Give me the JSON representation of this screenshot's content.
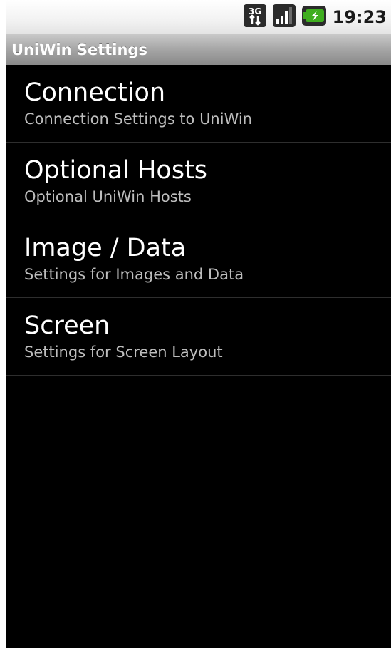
{
  "status_bar": {
    "network_badge": "3G",
    "network_icon": "3g-data-icon",
    "signal_icon": "signal-strength-icon",
    "battery_icon": "battery-charging-icon",
    "time": "19:23"
  },
  "title_bar": {
    "title": "UniWin Settings"
  },
  "preferences": [
    {
      "title": "Connection",
      "summary": "Connection Settings to UniWin"
    },
    {
      "title": "Optional Hosts",
      "summary": "Optional UniWin Hosts"
    },
    {
      "title": "Image / Data",
      "summary": "Settings for Images and Data"
    },
    {
      "title": "Screen",
      "summary": "Settings for Screen Layout"
    }
  ],
  "colors": {
    "background": "#000000",
    "title_bar": "#a2a2a2",
    "battery_green": "#3fae1f",
    "summary_text": "#bdbdbd"
  }
}
